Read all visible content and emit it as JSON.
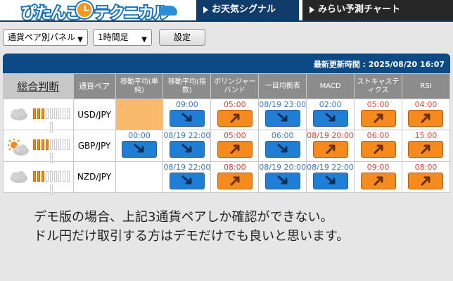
{
  "header": {
    "logo_part1": "ぴたんこ",
    "logo_part2": "テクニカル",
    "tab_signal": "お天気シグナル",
    "tab_forecast": "みらい予測チャート"
  },
  "controls": {
    "panel_select": "通貨ペア別パネル",
    "timeframe_select": "1時間足",
    "setting_button": "設定"
  },
  "table": {
    "last_update": "最新更新時間 : 2025/08/20 16:07",
    "headers": {
      "summary": "総合判断",
      "pair": "通貨ペア",
      "sma": "移動平均(単純)",
      "ema": "移動平均(指数)",
      "bollinger": "ボリンジャーバンド",
      "ichimoku": "一目均衡表",
      "macd": "MACD",
      "stochastics": "ストキャスティクス",
      "rsi": "RSI"
    },
    "rows": [
      {
        "pair": "USD/JPY",
        "weather": "cloudy-icon",
        "bars_on": 3,
        "sma": {
          "time": "",
          "dir": "",
          "time_color": ""
        },
        "ema": {
          "time": "09:00",
          "dir": "down",
          "time_color": "blue"
        },
        "bollinger": {
          "time": "05:00",
          "dir": "up",
          "time_color": "red"
        },
        "ichimoku": {
          "time": "08/19 23:00",
          "dir": "down",
          "time_color": "blue"
        },
        "macd": {
          "time": "02:00",
          "dir": "down",
          "time_color": "blue"
        },
        "stochastics": {
          "time": "05:00",
          "dir": "up",
          "time_color": "red"
        },
        "rsi": {
          "time": "04:00",
          "dir": "up",
          "time_color": "red"
        }
      },
      {
        "pair": "GBP/JPY",
        "weather": "partly-sunny-icon",
        "bars_on": 4,
        "sma": {
          "time": "00:00",
          "dir": "down",
          "time_color": "blue"
        },
        "ema": {
          "time": "08/19 22:00",
          "dir": "down",
          "time_color": "blue"
        },
        "bollinger": {
          "time": "05:00",
          "dir": "up",
          "time_color": "red"
        },
        "ichimoku": {
          "time": "06:00",
          "dir": "down",
          "time_color": "blue"
        },
        "macd": {
          "time": "08/19 20:00",
          "dir": "up",
          "time_color": "red"
        },
        "stochastics": {
          "time": "06:00",
          "dir": "up",
          "time_color": "red"
        },
        "rsi": {
          "time": "15:00",
          "dir": "up",
          "time_color": "red"
        }
      },
      {
        "pair": "NZD/JPY",
        "weather": "cloudy-icon",
        "bars_on": 3,
        "sma": {
          "time": "",
          "dir": "",
          "time_color": ""
        },
        "ema": {
          "time": "08/19 22:00",
          "dir": "down",
          "time_color": "blue"
        },
        "bollinger": {
          "time": "08:00",
          "dir": "up",
          "time_color": "red"
        },
        "ichimoku": {
          "time": "08/19 20:00",
          "dir": "down",
          "time_color": "blue"
        },
        "macd": {
          "time": "08/19 22:00",
          "dir": "down",
          "time_color": "blue"
        },
        "stochastics": {
          "time": "09:00",
          "dir": "up",
          "time_color": "red"
        },
        "rsi": {
          "time": "08:00",
          "dir": "up",
          "time_color": "red"
        }
      }
    ]
  },
  "note": {
    "line1": "デモ版の場合、上記3通貨ペアしか確認ができない。",
    "line2": "ドル円だけ取引する方はデモだけでも良いと思います。"
  },
  "colors": {
    "nav_active": "#0f3c6a",
    "table_header": "#0c4a86",
    "signal_up": "#f58a1f",
    "signal_down": "#1f7fd4"
  }
}
